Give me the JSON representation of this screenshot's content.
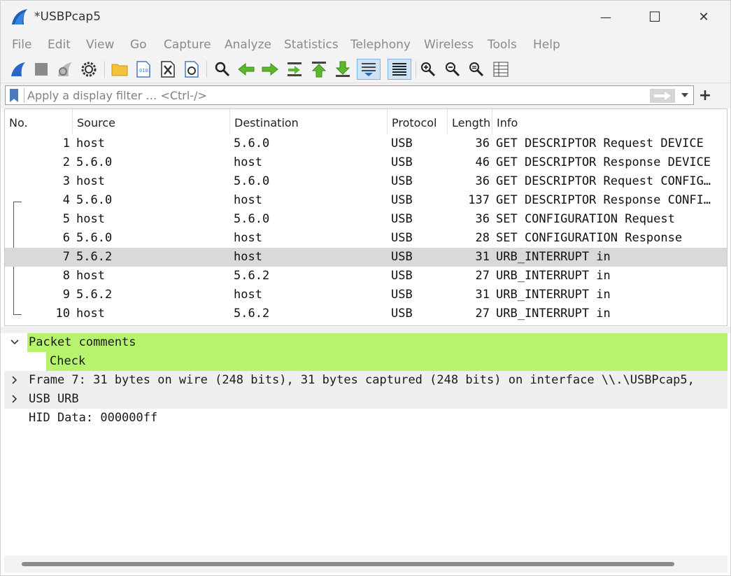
{
  "window": {
    "title": "*USBPcap5",
    "min_icon": "—",
    "max_icon": "☐",
    "close_icon": "✕"
  },
  "menu": [
    "File",
    "Edit",
    "View",
    "Go",
    "Capture",
    "Analyze",
    "Statistics",
    "Telephony",
    "Wireless",
    "Tools",
    "Help"
  ],
  "toolbar_icons": [
    "start-capture",
    "stop-capture",
    "restart-capture",
    "capture-options",
    "open-file",
    "save-file",
    "close-file",
    "reload-file",
    "find-packet",
    "go-back",
    "go-forward",
    "go-to-packet",
    "go-first",
    "go-last",
    "auto-scroll",
    "colorize",
    "zoom-in",
    "zoom-out",
    "zoom-normal",
    "resize-columns"
  ],
  "filter": {
    "placeholder": "Apply a display filter … <Ctrl-/>",
    "value": ""
  },
  "packet_list": {
    "columns": [
      "No.",
      "Source",
      "Destination",
      "Protocol",
      "Length",
      "Info"
    ],
    "rows": [
      {
        "no": "1",
        "src": "host",
        "dst": "5.6.0",
        "proto": "USB",
        "len": "36",
        "info": "GET DESCRIPTOR Request DEVICE"
      },
      {
        "no": "2",
        "src": "5.6.0",
        "dst": "host",
        "proto": "USB",
        "len": "46",
        "info": "GET DESCRIPTOR Response DEVICE"
      },
      {
        "no": "3",
        "src": "host",
        "dst": "5.6.0",
        "proto": "USB",
        "len": "36",
        "info": "GET DESCRIPTOR Request CONFIG…"
      },
      {
        "no": "4",
        "src": "5.6.0",
        "dst": "host",
        "proto": "USB",
        "len": "137",
        "info": "GET DESCRIPTOR Response CONFI…"
      },
      {
        "no": "5",
        "src": "host",
        "dst": "5.6.0",
        "proto": "USB",
        "len": "36",
        "info": "SET CONFIGURATION Request"
      },
      {
        "no": "6",
        "src": "5.6.0",
        "dst": "host",
        "proto": "USB",
        "len": "28",
        "info": "SET CONFIGURATION Response"
      },
      {
        "no": "7",
        "src": "5.6.2",
        "dst": "host",
        "proto": "USB",
        "len": "31",
        "info": "URB_INTERRUPT in"
      },
      {
        "no": "8",
        "src": "host",
        "dst": "5.6.2",
        "proto": "USB",
        "len": "27",
        "info": "URB_INTERRUPT in"
      },
      {
        "no": "9",
        "src": "5.6.2",
        "dst": "host",
        "proto": "USB",
        "len": "31",
        "info": "URB_INTERRUPT in"
      },
      {
        "no": "10",
        "src": "host",
        "dst": "5.6.2",
        "proto": "USB",
        "len": "27",
        "info": "URB_INTERRUPT in"
      }
    ],
    "selected_row": 7
  },
  "details": {
    "packet_comments": "Packet comments",
    "comment": "Check",
    "frame": "Frame 7: 31 bytes on wire (248 bits), 31 bytes captured (248 bits) on interface \\\\.\\USBPcap5,",
    "usb_urb": "USB URB",
    "hid_data": "HID Data: 000000ff"
  },
  "colors": {
    "comment_highlight": "#b7f46e",
    "selected_row": "#d9d9d9",
    "accent_blue": "#4a78c2"
  }
}
